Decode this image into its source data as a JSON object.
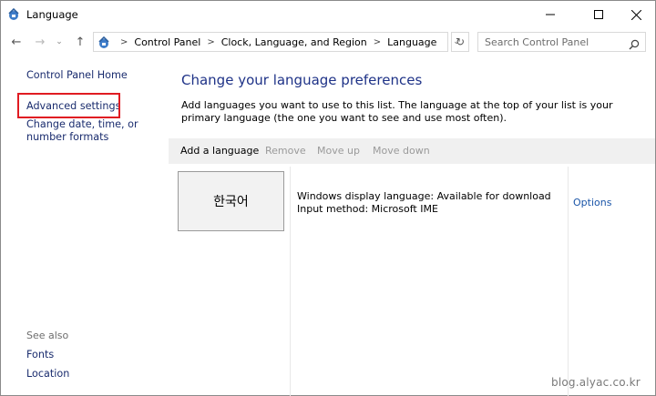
{
  "window": {
    "title": "Language",
    "icons": {
      "app": "control-panel-icon",
      "minimize": "minimize-icon",
      "maximize": "maximize-icon",
      "close": "close-icon"
    }
  },
  "nav": {
    "back": "←",
    "forward": "→",
    "recent": "⌄",
    "up": "↑",
    "breadcrumbs": [
      "Control Panel",
      "Clock, Language, and Region",
      "Language"
    ],
    "separator": ">",
    "dropdown": "⌄",
    "refresh": "↻",
    "search_placeholder": "Search Control Panel"
  },
  "sidebar": {
    "home": "Control Panel Home",
    "advanced": "Advanced settings",
    "date_formats": "Change date, time, or number formats",
    "see_also_label": "See also",
    "fonts": "Fonts",
    "location": "Location"
  },
  "main": {
    "title": "Change your language preferences",
    "description": "Add languages you want to use to this list. The language at the top of your list is your primary language (the one you want to see and use most often).",
    "toolbar": {
      "add": "Add a language",
      "remove": "Remove",
      "move_up": "Move up",
      "move_down": "Move down"
    },
    "languages": [
      {
        "name": "한국어",
        "display": "Windows display language: Available for download",
        "input": "Input method: Microsoft IME",
        "options": "Options"
      }
    ]
  },
  "watermark": "blog.alyac.co.kr",
  "colors": {
    "link": "#1a2c6e",
    "heading": "#1e3287",
    "highlight": "#e01b22",
    "disabled": "#9a9a9a",
    "toolbar_bg": "#f0f0f0"
  }
}
